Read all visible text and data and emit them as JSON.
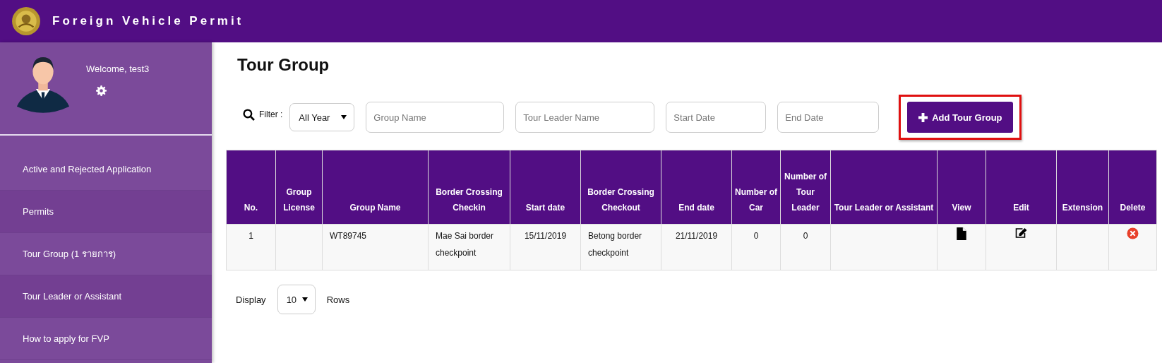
{
  "header": {
    "title": "Foreign Vehicle Permit"
  },
  "user": {
    "welcome": "Welcome, test3"
  },
  "sidebar": {
    "items": [
      {
        "label": "Active and Rejected Application"
      },
      {
        "label": "Permits"
      },
      {
        "label": "Tour Group (1 รายการ)"
      },
      {
        "label": "Tour Leader or Assistant"
      },
      {
        "label": "How to apply for FVP"
      }
    ]
  },
  "page_title": "Tour Group",
  "filter": {
    "label": "Filter :",
    "year_select": "All Year",
    "fields": [
      {
        "placeholder": "Group Name"
      },
      {
        "placeholder": "Tour Leader Name"
      },
      {
        "placeholder": "Start Date"
      },
      {
        "placeholder": "End Date"
      }
    ],
    "add_button": {
      "label": "Add Tour Group",
      "highlighted": true
    }
  },
  "table": {
    "columns": [
      "No.",
      "Group License",
      "Group Name",
      "Border Crossing Checkin",
      "Start date",
      "Border Crossing Checkout",
      "End date",
      "Number of Car",
      "Number of Tour Leader",
      "Tour Leader or Assistant",
      "View",
      "Edit",
      "Extension",
      "Delete"
    ],
    "rows": [
      {
        "cells": [
          "1",
          "",
          "WT89745",
          "Mae Sai border checkpoint",
          "15/11/2019",
          "Betong border checkpoint",
          "21/11/2019",
          "0",
          "0",
          ""
        ]
      }
    ]
  },
  "pagination": {
    "label": "Display",
    "rows_select": "10",
    "suffix": "Rows"
  }
}
